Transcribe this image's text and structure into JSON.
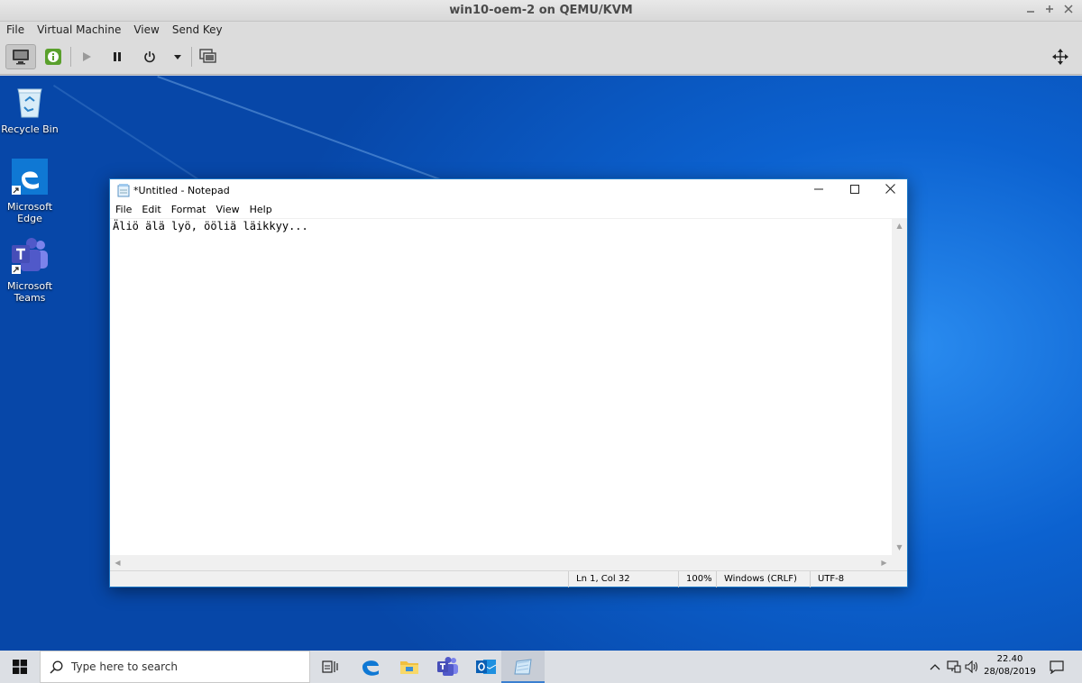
{
  "host": {
    "window_title": "win10-oem-2 on QEMU/KVM",
    "menu": [
      "File",
      "Virtual Machine",
      "View",
      "Send Key"
    ]
  },
  "desktop": {
    "icons": [
      {
        "label": "Recycle Bin"
      },
      {
        "label": "Microsoft Edge"
      },
      {
        "label": "Microsoft Teams"
      }
    ]
  },
  "notepad": {
    "title": "*Untitled - Notepad",
    "menu": [
      "File",
      "Edit",
      "Format",
      "View",
      "Help"
    ],
    "content": "Äliö älä lyö, ööliä läikkyy...",
    "status": {
      "position": "Ln 1, Col 32",
      "zoom": "100%",
      "line_ending": "Windows (CRLF)",
      "encoding": "UTF-8"
    }
  },
  "taskbar": {
    "search_placeholder": "Type here to search",
    "time": "22.40",
    "date": "28/08/2019"
  },
  "colors": {
    "desktop_blue": "#0c62d0",
    "window_border": "#1c78c8"
  }
}
